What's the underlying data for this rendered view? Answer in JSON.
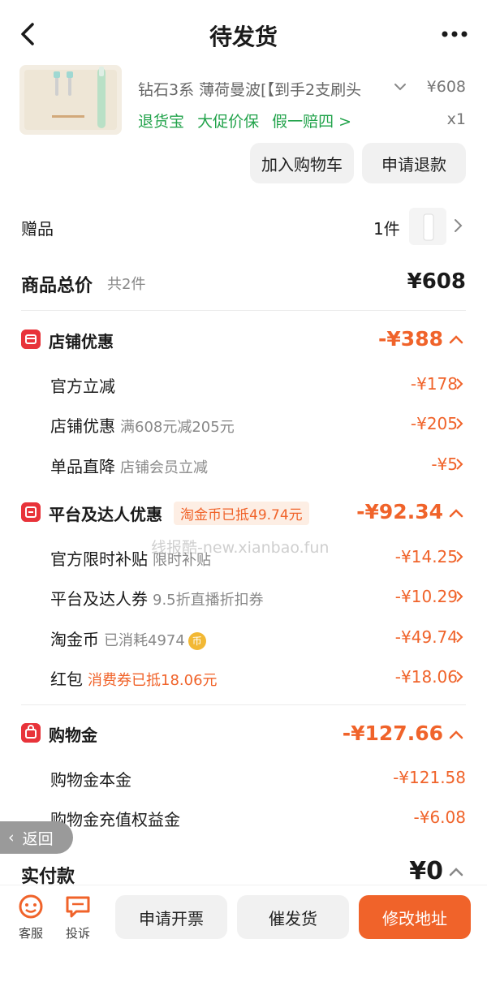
{
  "header": {
    "title": "待发货"
  },
  "product": {
    "name": "钻石3系 薄荷曼波[【到手2支刷头",
    "price": "¥608",
    "tags": [
      "退货宝",
      "大促价保",
      "假一赔四 >"
    ],
    "qty": "x1",
    "add_cart_label": "加入购物车",
    "refund_label": "申请退款"
  },
  "gift": {
    "label": "赠品",
    "count": "1件"
  },
  "total": {
    "label": "商品总价",
    "count": "共2件",
    "price": "¥608"
  },
  "shop_discount": {
    "title": "店铺优惠",
    "amount": "-¥388",
    "rows": [
      {
        "label": "官方立减",
        "sub": "",
        "amount": "-¥178"
      },
      {
        "label": "店铺优惠",
        "sub": "满608元减205元",
        "amount": "-¥205"
      },
      {
        "label": "单品直降",
        "sub": "店铺会员立减",
        "amount": "-¥5"
      }
    ]
  },
  "platform_discount": {
    "title": "平台及达人优惠",
    "tag": "淘金币已抵49.74元",
    "amount": "-¥92.34",
    "rows": [
      {
        "label": "官方限时补贴",
        "sub": "限时补贴",
        "amount": "-¥14.25"
      },
      {
        "label": "平台及达人券",
        "sub": "9.5折直播折扣券",
        "amount": "-¥10.29"
      },
      {
        "label": "淘金币",
        "sub": "已消耗4974",
        "amount": "-¥49.74"
      },
      {
        "label": "红包",
        "sub": "消费券已抵18.06元",
        "amount": "-¥18.06"
      }
    ]
  },
  "shopping_gold": {
    "title": "购物金",
    "amount": "-¥127.66",
    "rows": [
      {
        "label": "购物金本金",
        "amount": "-¥121.58"
      },
      {
        "label": "购物金充值权益金",
        "amount": "-¥6.08"
      }
    ]
  },
  "watermark": "线报酷-new.xianbao.fun",
  "back_float": "返回",
  "paid": {
    "label": "实付款",
    "amount": "¥0"
  },
  "bottom": {
    "service_label": "客服",
    "complaint_label": "投诉",
    "invoice_label": "申请开票",
    "urge_label": "催发货",
    "address_label": "修改地址"
  },
  "coin_glyph": "币",
  "colors": {
    "accent": "#f0632a",
    "green": "#22a34b",
    "red_icon": "#e8333a"
  }
}
